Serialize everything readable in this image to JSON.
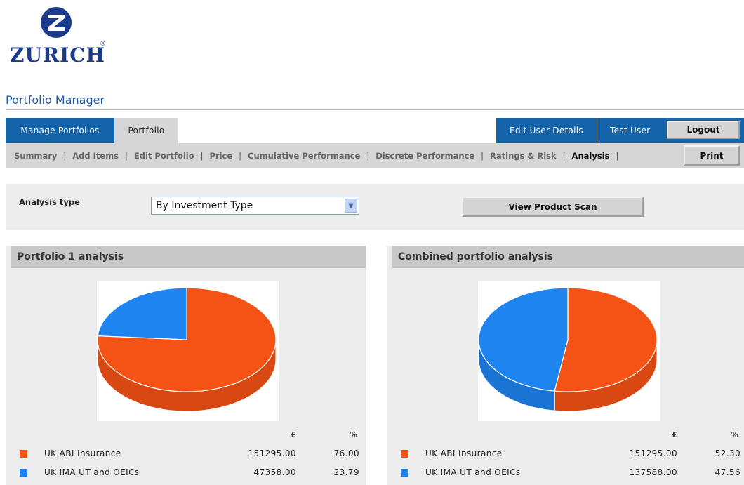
{
  "brand": {
    "name": "ZURICH",
    "registered": "®",
    "mark": "Z"
  },
  "app_title": "Portfolio Manager",
  "topnav": {
    "manage_portfolios": "Manage Portfolios",
    "portfolio": "Portfolio",
    "edit_user_details": "Edit User Details",
    "user_name": "Test User",
    "logout": "Logout"
  },
  "subnav": {
    "items": [
      "Summary",
      "Add Items",
      "Edit Portfolio",
      "Price",
      "Cumulative Performance",
      "Discrete Performance",
      "Ratings & Risk",
      "Analysis"
    ],
    "active": "Analysis",
    "separator": "|",
    "print": "Print"
  },
  "analysis": {
    "label": "Analysis type",
    "selected": "By Investment Type",
    "view_scan": "View Product Scan"
  },
  "colors": {
    "orange": "#f55215",
    "blue": "#1e84f0",
    "nav_blue": "#1563a8"
  },
  "panels": [
    {
      "title": "Portfolio 1 analysis",
      "col_amount": "£",
      "col_pct": "%",
      "rows": [
        {
          "label": "UK ABI Insurance",
          "amount": "151295.00",
          "pct": "76.00",
          "color": "#f55215"
        },
        {
          "label": "UK IMA UT and OEICs",
          "amount": "47358.00",
          "pct": "23.79",
          "color": "#1e84f0"
        }
      ]
    },
    {
      "title": "Combined portfolio analysis",
      "col_amount": "£",
      "col_pct": "%",
      "rows": [
        {
          "label": "UK ABI Insurance",
          "amount": "151295.00",
          "pct": "52.30",
          "color": "#f55215"
        },
        {
          "label": "UK IMA UT and OEICs",
          "amount": "137588.00",
          "pct": "47.56",
          "color": "#1e84f0"
        }
      ]
    }
  ],
  "chart_data": [
    {
      "type": "pie",
      "categories": [
        "UK ABI Insurance",
        "UK IMA UT and OEICs"
      ],
      "values": [
        76.0,
        23.79
      ]
    },
    {
      "type": "pie",
      "categories": [
        "UK ABI Insurance",
        "UK IMA UT and OEICs"
      ],
      "values": [
        52.3,
        47.56
      ]
    }
  ]
}
